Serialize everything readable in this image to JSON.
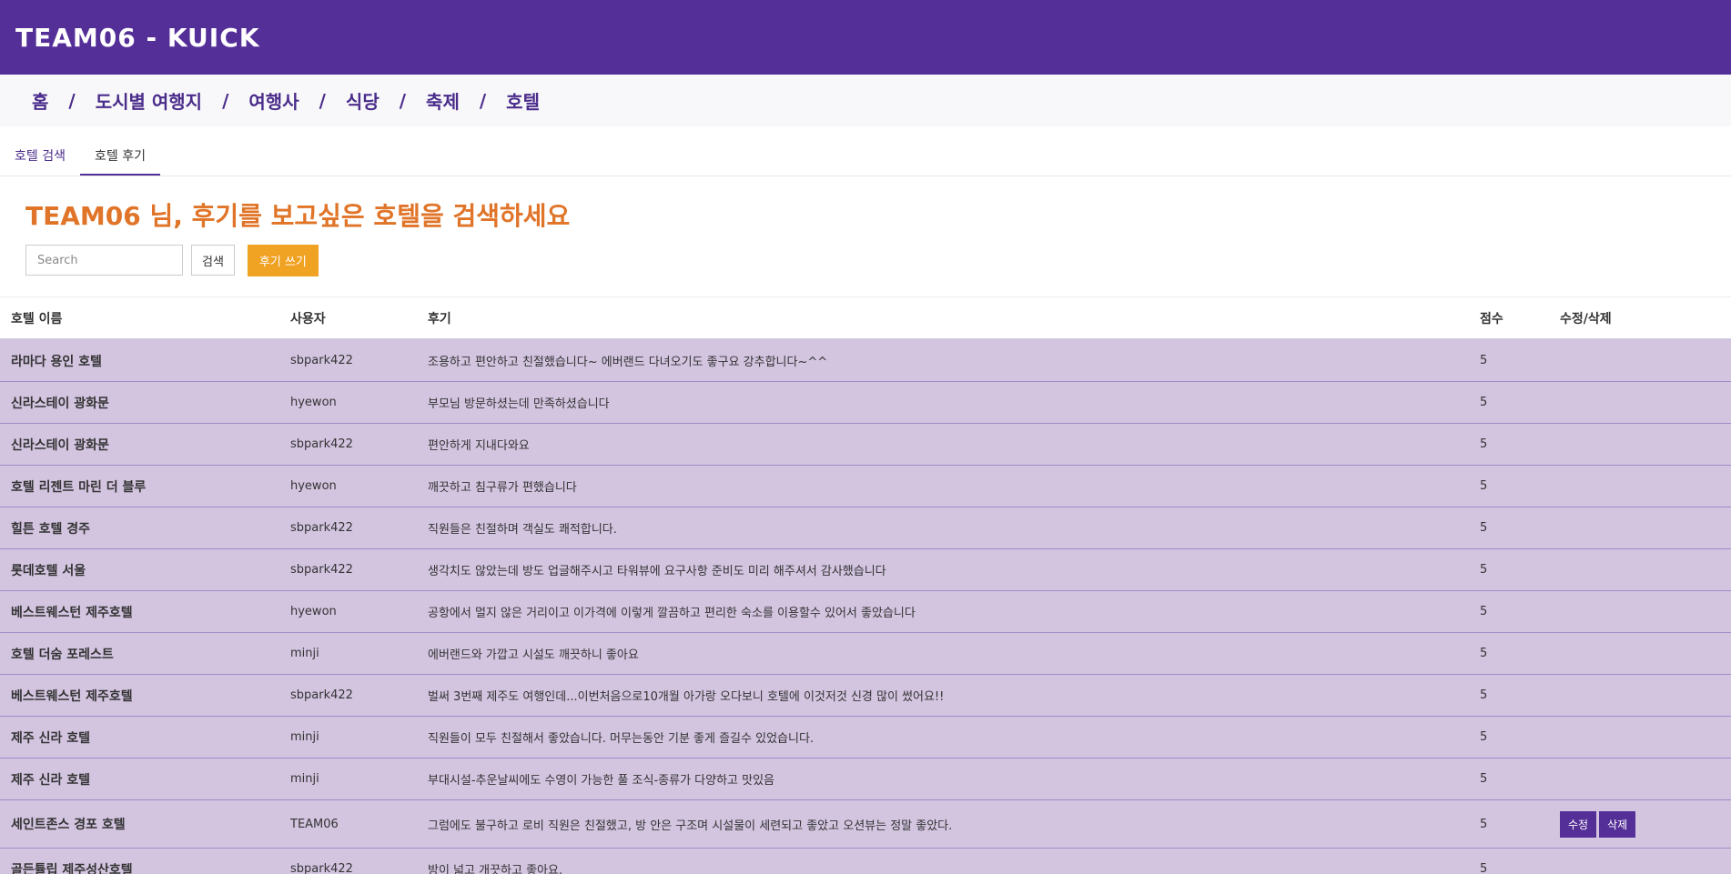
{
  "header": {
    "brand": "TEAM06 - KUICK"
  },
  "nav": {
    "items": [
      {
        "label": "홈"
      },
      {
        "label": "도시별 여행지"
      },
      {
        "label": "여행사"
      },
      {
        "label": "식당"
      },
      {
        "label": "축제"
      },
      {
        "label": "호텔"
      }
    ],
    "separator": "/"
  },
  "tabs": [
    {
      "label": "호텔 검색",
      "active": false
    },
    {
      "label": "호텔 후기",
      "active": true
    }
  ],
  "main": {
    "heading": "TEAM06 님, 후기를 보고싶은 호텔을 검색하세요",
    "search_placeholder": "Search",
    "search_button": "검색",
    "write_button": "후기 쓰기"
  },
  "colors": {
    "header_bg": "#552f98",
    "heading": "#e07428",
    "write_button": "#f0a223",
    "row_bg": "#d3c4e0"
  },
  "table": {
    "headers": {
      "hotel": "호텔 이름",
      "user": "사용자",
      "review": "후기",
      "score": "점수",
      "actions": "수정/삭제"
    },
    "edit_label": "수정",
    "delete_label": "삭제",
    "rows": [
      {
        "hotel": "라마다 용인 호텔",
        "user": "sbpark422",
        "review": "조용하고 편안하고 친절했습니다~ 에버랜드 다녀오기도 좋구요 강추합니다~^^",
        "score": "5"
      },
      {
        "hotel": "신라스테이 광화문",
        "user": "hyewon",
        "review": "부모님 방문하셨는데 만족하셨습니다",
        "score": "5"
      },
      {
        "hotel": "신라스테이 광화문",
        "user": "sbpark422",
        "review": "편안하게 지내다와요",
        "score": "5"
      },
      {
        "hotel": "호텔 리젠트 마린 더 블루",
        "user": "hyewon",
        "review": "깨끗하고 침구류가 편했습니다",
        "score": "5"
      },
      {
        "hotel": "힐튼 호텔 경주",
        "user": "sbpark422",
        "review": "직원들은 친절하며 객실도 쾌적합니다.",
        "score": "5"
      },
      {
        "hotel": "롯데호텔 서울",
        "user": "sbpark422",
        "review": "생각치도 않았는데 방도 업글해주시고 타워뷰에 요구사항 준비도 미리 해주셔서 감사했습니다",
        "score": "5"
      },
      {
        "hotel": "베스트웨스턴 제주호텔",
        "user": "hyewon",
        "review": "공항에서 멀지 않은 거리이고 이가격에 이렇게 깔끔하고 편리한 숙소를 이용할수 있어서 좋았습니다",
        "score": "5"
      },
      {
        "hotel": "호텔 더숨 포레스트",
        "user": "minji",
        "review": "에버랜드와 가깝고 시설도 깨끗하니 좋아요",
        "score": "5"
      },
      {
        "hotel": "베스트웨스턴 제주호텔",
        "user": "sbpark422",
        "review": "벌써 3번째 제주도 여행인데...이번처음으로10개월 아가랑 오다보니 호텔에 이것저것 신경 많이 썼어요!!",
        "score": "5"
      },
      {
        "hotel": "제주 신라 호텔",
        "user": "minji",
        "review": "직원들이 모두 친절해서 좋았습니다. 머무는동안 기분 좋게 즐길수 있었습니다.",
        "score": "5"
      },
      {
        "hotel": "제주 신라 호텔",
        "user": "minji",
        "review": "부대시설-추운날씨에도 수영이 가능한 풀 조식-종류가 다양하고 맛있음",
        "score": "5"
      },
      {
        "hotel": "세인트존스 경포 호텔",
        "user": "TEAM06",
        "review": "그럼에도 불구하고 로비 직원은 친절했고, 방 안은 구조며 시설물이 세련되고 좋았고 오션뷰는 정말 좋았다.",
        "score": "5",
        "editable": true
      },
      {
        "hotel": "골든튤립 제주성산호텔",
        "user": "sbpark422",
        "review": "방이 넓고 개끗하고 좋아요.",
        "score": "5"
      }
    ]
  }
}
